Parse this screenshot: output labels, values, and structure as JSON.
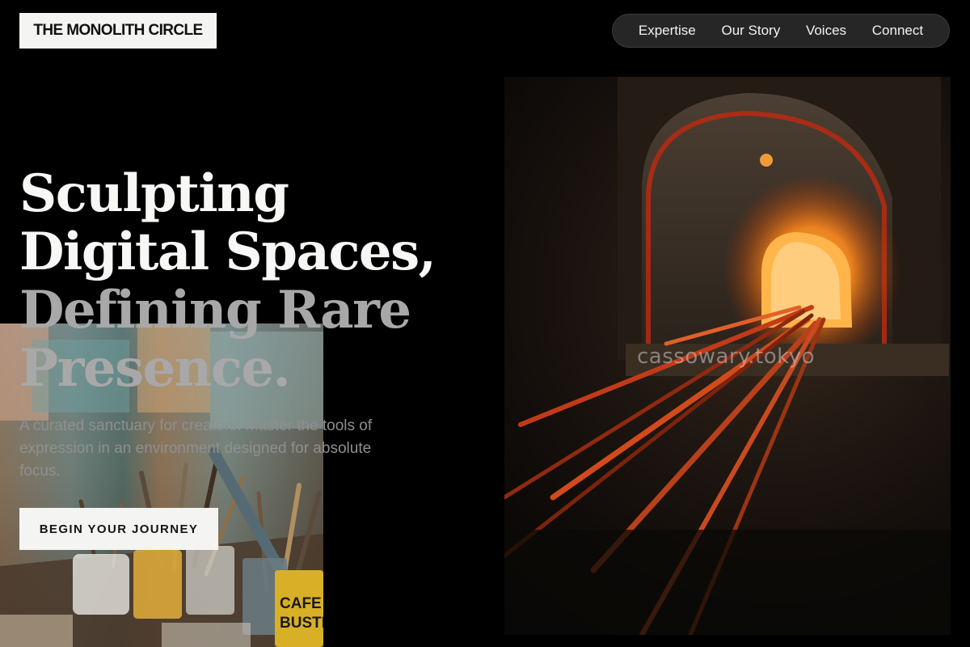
{
  "header": {
    "logo_text": "THE MONOLITH CIRCLE",
    "nav": [
      {
        "label": "Expertise"
      },
      {
        "label": "Our Story"
      },
      {
        "label": "Voices"
      },
      {
        "label": "Connect"
      }
    ]
  },
  "hero": {
    "headline_lines": [
      "Sculpting",
      "Digital Spaces,",
      "Defining Rare",
      "Presence."
    ],
    "lede": "A curated sanctuary for creators. Master the tools of expression in an environment designed for absolute focus.",
    "cta_label": "BEGIN YOUR JOURNEY"
  },
  "images": {
    "kiln_watermark": "cassowary.tokyo",
    "studio_can_label_1": "CAFE",
    "studio_can_label_2": "BUSTE"
  },
  "colors": {
    "background": "#000000",
    "button_bg": "#f4f4f2",
    "nav_bg": "#262626",
    "headline_primary": "#f7f7f5",
    "headline_secondary": "#a8a8a8"
  }
}
